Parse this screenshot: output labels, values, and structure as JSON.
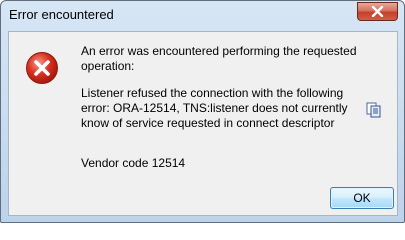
{
  "window": {
    "title": "Error encountered",
    "close_icon": "close-icon"
  },
  "dialog": {
    "icon": "error-icon",
    "message": "An error was encountered performing the requested operation:",
    "detail": "Listener refused the connection with the following error: ORA-12514, TNS:listener does not currently know of service requested in connect descriptor",
    "copy_icon": "copy-icon",
    "vendor_code": "Vendor code 12514",
    "ok_label": "OK"
  },
  "colors": {
    "frame": "#c6d9ee",
    "client_bg": "#f0f0f0",
    "close_red": "#c2412b",
    "error_red": "#d9301f"
  }
}
